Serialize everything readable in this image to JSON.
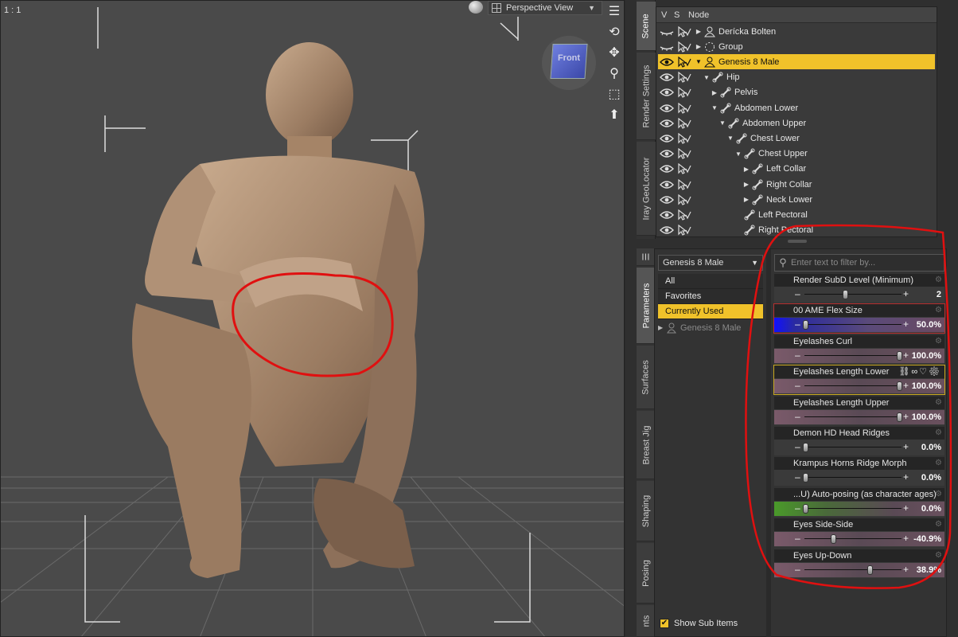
{
  "viewport": {
    "ratio": "1 : 1",
    "view_name": "Perspective View",
    "nav_cube_label": "Front"
  },
  "side_tabs_top": [
    "Scene",
    "Render Settings",
    "Iray GeoLocator"
  ],
  "side_tabs_bottom": [
    "Parameters",
    "Surfaces",
    "Breast Jig",
    "Shaping",
    "Posing",
    "nts"
  ],
  "scene": {
    "header": {
      "v": "V",
      "s": "S",
      "node": "Node"
    },
    "rows": [
      {
        "label": "Derícka Bolten",
        "depth": 0,
        "arrow": "▶",
        "icon": "figure-icon",
        "eye": "closed",
        "selected": false
      },
      {
        "label": "Group",
        "depth": 0,
        "arrow": "▶",
        "icon": "group-icon",
        "eye": "closed",
        "selected": false
      },
      {
        "label": "Genesis 8 Male",
        "depth": 0,
        "arrow": "▼",
        "icon": "figure-icon",
        "eye": "open",
        "selected": true
      },
      {
        "label": "Hip",
        "depth": 1,
        "arrow": "▼",
        "icon": "bone-icon",
        "eye": "open",
        "selected": false
      },
      {
        "label": "Pelvis",
        "depth": 2,
        "arrow": "▶",
        "icon": "bone-icon",
        "eye": "open",
        "selected": false
      },
      {
        "label": "Abdomen Lower",
        "depth": 2,
        "arrow": "▼",
        "icon": "bone-icon",
        "eye": "open",
        "selected": false
      },
      {
        "label": "Abdomen Upper",
        "depth": 3,
        "arrow": "▼",
        "icon": "bone-icon",
        "eye": "open",
        "selected": false
      },
      {
        "label": "Chest Lower",
        "depth": 4,
        "arrow": "▼",
        "icon": "bone-icon",
        "eye": "open",
        "selected": false
      },
      {
        "label": "Chest Upper",
        "depth": 5,
        "arrow": "▼",
        "icon": "bone-icon",
        "eye": "open",
        "selected": false
      },
      {
        "label": "Left Collar",
        "depth": 6,
        "arrow": "▶",
        "icon": "bone-icon",
        "eye": "open",
        "selected": false
      },
      {
        "label": "Right Collar",
        "depth": 6,
        "arrow": "▶",
        "icon": "bone-icon",
        "eye": "open",
        "selected": false
      },
      {
        "label": "Neck Lower",
        "depth": 6,
        "arrow": "▶",
        "icon": "bone-icon",
        "eye": "open",
        "selected": false
      },
      {
        "label": "Left Pectoral",
        "depth": 5,
        "arrow": "",
        "icon": "bone-icon",
        "eye": "open",
        "selected": false
      },
      {
        "label": "Right Pectoral",
        "depth": 5,
        "arrow": "",
        "icon": "bone-icon",
        "eye": "open",
        "selected": false
      }
    ]
  },
  "parameters": {
    "node_select": "Genesis 8 Male",
    "categories": [
      {
        "label": "All",
        "active": false
      },
      {
        "label": "Favorites",
        "active": false
      },
      {
        "label": "Currently Used",
        "active": true
      }
    ],
    "tree_node": "Genesis 8 Male",
    "show_sub_items": "Show Sub Items",
    "filter_placeholder": "Enter text to filter by...",
    "sliders": [
      {
        "label": "Render SubD Level (Minimum)",
        "value": "2",
        "fraction": 0.42,
        "tint": "none",
        "highlight": false
      },
      {
        "label": "00 AME Flex Size",
        "value": "50.0%",
        "fraction": 0.0,
        "tint": "blue",
        "highlight": false
      },
      {
        "label": "Eyelashes Curl",
        "value": "100.0%",
        "fraction": 1.0,
        "tint": "mauve",
        "highlight": false
      },
      {
        "label": "Eyelashes Length Lower",
        "value": "100.0%",
        "fraction": 1.0,
        "tint": "mauve",
        "highlight": true
      },
      {
        "label": "Eyelashes Length Upper",
        "value": "100.0%",
        "fraction": 1.0,
        "tint": "mauve",
        "highlight": false
      },
      {
        "label": "Demon HD Head Ridges",
        "value": "0.0%",
        "fraction": 0.0,
        "tint": "none",
        "highlight": false
      },
      {
        "label": "Krampus Horns Ridge Morph",
        "value": "0.0%",
        "fraction": 0.0,
        "tint": "none",
        "highlight": false
      },
      {
        "label": "...U) Auto-posing (as character ages)",
        "value": "0.0%",
        "fraction": 0.0,
        "tint": "green",
        "highlight": false
      },
      {
        "label": "Eyes Side-Side",
        "value": "-40.9%",
        "fraction": 0.3,
        "tint": "mauve",
        "highlight": false
      },
      {
        "label": "Eyes Up-Down",
        "value": "38.9%",
        "fraction": 0.69,
        "tint": "mauve",
        "highlight": false
      }
    ]
  },
  "colors": {
    "selection": "#f0c22a",
    "annotation": "#e01010"
  }
}
